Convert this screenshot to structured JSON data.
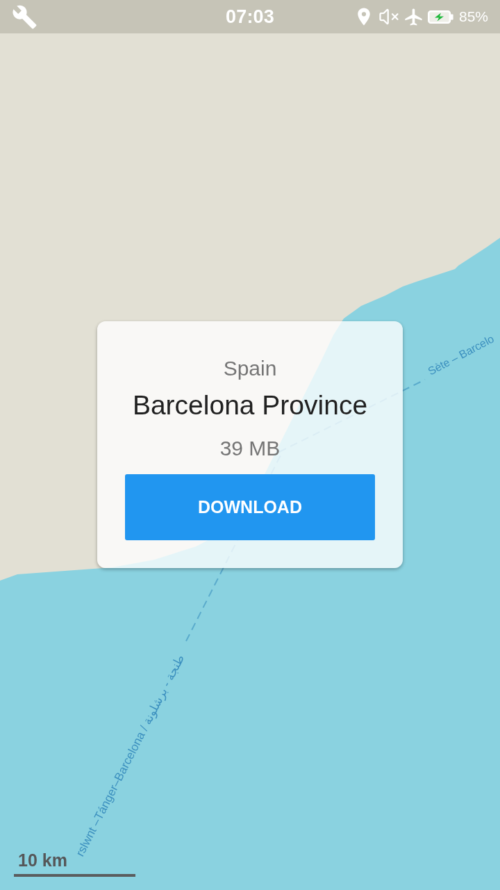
{
  "status_bar": {
    "time": "07:03",
    "battery": "85%"
  },
  "map": {
    "route_labels": [
      "Sète – Barcelo",
      "rslwnt –Tánger–Barcelona / طنجة - برشلونة"
    ],
    "scale": "10 km"
  },
  "card": {
    "country": "Spain",
    "region": "Barcelona Province",
    "size": "39 MB",
    "button": "DOWNLOAD"
  }
}
